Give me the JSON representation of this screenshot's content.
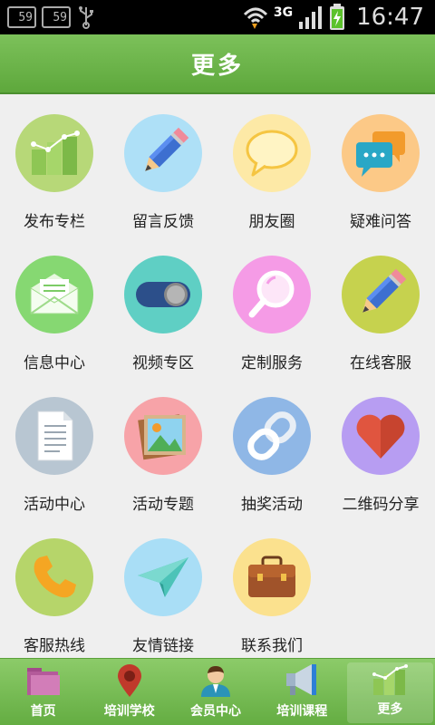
{
  "status_bar": {
    "badge_left_1": "59",
    "badge_left_2": "59",
    "network": "3G",
    "time": "16:47"
  },
  "header": {
    "title": "更多"
  },
  "grid": {
    "items": [
      {
        "label": "发布专栏",
        "icon": "bar-chart-icon",
        "color": "#b7d878"
      },
      {
        "label": "留言反馈",
        "icon": "pencil-icon",
        "color": "#aee0f7"
      },
      {
        "label": "朋友圈",
        "icon": "speech-bubble-icon",
        "color": "#fde9a6"
      },
      {
        "label": "疑难问答",
        "icon": "chat-bubbles-icon",
        "color": "#fcc987"
      },
      {
        "label": "信息中心",
        "icon": "envelope-icon",
        "color": "#86d872"
      },
      {
        "label": "视频专区",
        "icon": "toggle-icon",
        "color": "#5fcfc4"
      },
      {
        "label": "定制服务",
        "icon": "magnifier-icon",
        "color": "#f59be6"
      },
      {
        "label": "在线客服",
        "icon": "pencil-icon",
        "color": "#c6d24e"
      },
      {
        "label": "活动中心",
        "icon": "document-icon",
        "color": "#b8c6d2"
      },
      {
        "label": "活动专题",
        "icon": "photo-icon",
        "color": "#f7a3a8"
      },
      {
        "label": "抽奖活动",
        "icon": "link-icon",
        "color": "#8fb7e6"
      },
      {
        "label": "二维码分享",
        "icon": "heart-icon",
        "color": "#b79df2"
      },
      {
        "label": "客服热线",
        "icon": "phone-icon",
        "color": "#b6d56a"
      },
      {
        "label": "友情链接",
        "icon": "paper-plane-icon",
        "color": "#a9def6"
      },
      {
        "label": "联系我们",
        "icon": "briefcase-icon",
        "color": "#fbe18e"
      }
    ]
  },
  "tabbar": {
    "tabs": [
      {
        "label": "首页",
        "icon": "folder-icon"
      },
      {
        "label": "培训学校",
        "icon": "map-pin-icon"
      },
      {
        "label": "会员中心",
        "icon": "user-icon"
      },
      {
        "label": "培训课程",
        "icon": "megaphone-icon"
      },
      {
        "label": "更多",
        "icon": "bar-chart-icon",
        "active": true
      }
    ]
  },
  "colors": {
    "accent": "#66b045",
    "header_green": "#6cb44a"
  }
}
